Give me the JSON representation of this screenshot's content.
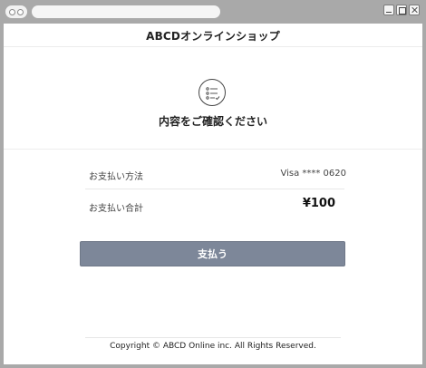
{
  "header": {
    "title": "ABCDオンラインショップ"
  },
  "confirmation": {
    "title": "内容をご確認ください",
    "icon": "checklist-icon"
  },
  "payment": {
    "method_label": "お支払い方法",
    "method_value": "Visa **** 0620",
    "total_label": "お支払い合計",
    "total_value": "¥100"
  },
  "actions": {
    "pay_label": "支払う",
    "pay_color": "#7d8799"
  },
  "footer": {
    "copyright": "Copyright © ABCD Online inc. All Rights Reserved."
  }
}
